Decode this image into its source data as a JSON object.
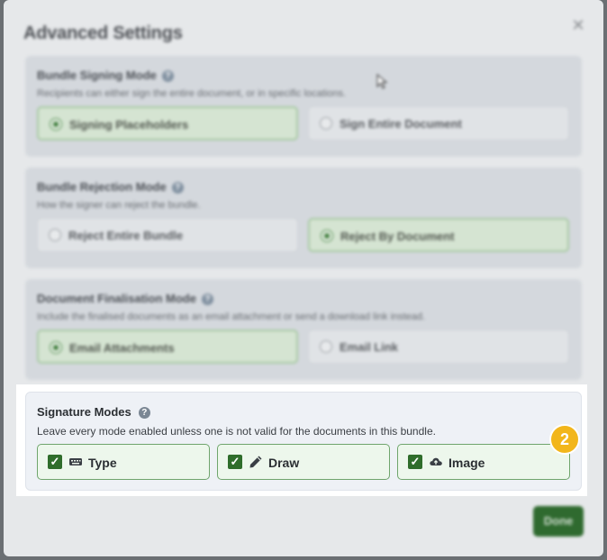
{
  "modal": {
    "title": "Advanced Settings",
    "close_symbol": "✕",
    "done_label": "Done"
  },
  "bundle_signing": {
    "title": "Bundle Signing Mode",
    "description": "Recipients can either sign the entire document, or in specific locations.",
    "options": [
      "Signing Placeholders",
      "Sign Entire Document"
    ],
    "selected": "Signing Placeholders"
  },
  "bundle_rejection": {
    "title": "Bundle Rejection Mode",
    "description": "How the signer can reject the bundle.",
    "options": [
      "Reject Entire Bundle",
      "Reject By Document"
    ],
    "selected": "Reject By Document"
  },
  "document_finalisation": {
    "title": "Document Finalisation Mode",
    "description": "Include the finalised documents as an email attachment or send a download link instead.",
    "options": [
      "Email Attachments",
      "Email Link"
    ],
    "selected": "Email Attachments"
  },
  "signature_modes": {
    "title": "Signature Modes",
    "description": "Leave every mode enabled unless one is not valid for the documents in this bundle.",
    "modes": [
      {
        "label": "Type",
        "icon": "keyboard-icon",
        "checked": true
      },
      {
        "label": "Draw",
        "icon": "pencil-icon",
        "checked": true
      },
      {
        "label": "Image",
        "icon": "cloud-upload-icon",
        "checked": true
      }
    ]
  },
  "step_badge": "2",
  "colors": {
    "accent_green": "#2f6d2b",
    "badge_yellow": "#f2b61b"
  }
}
